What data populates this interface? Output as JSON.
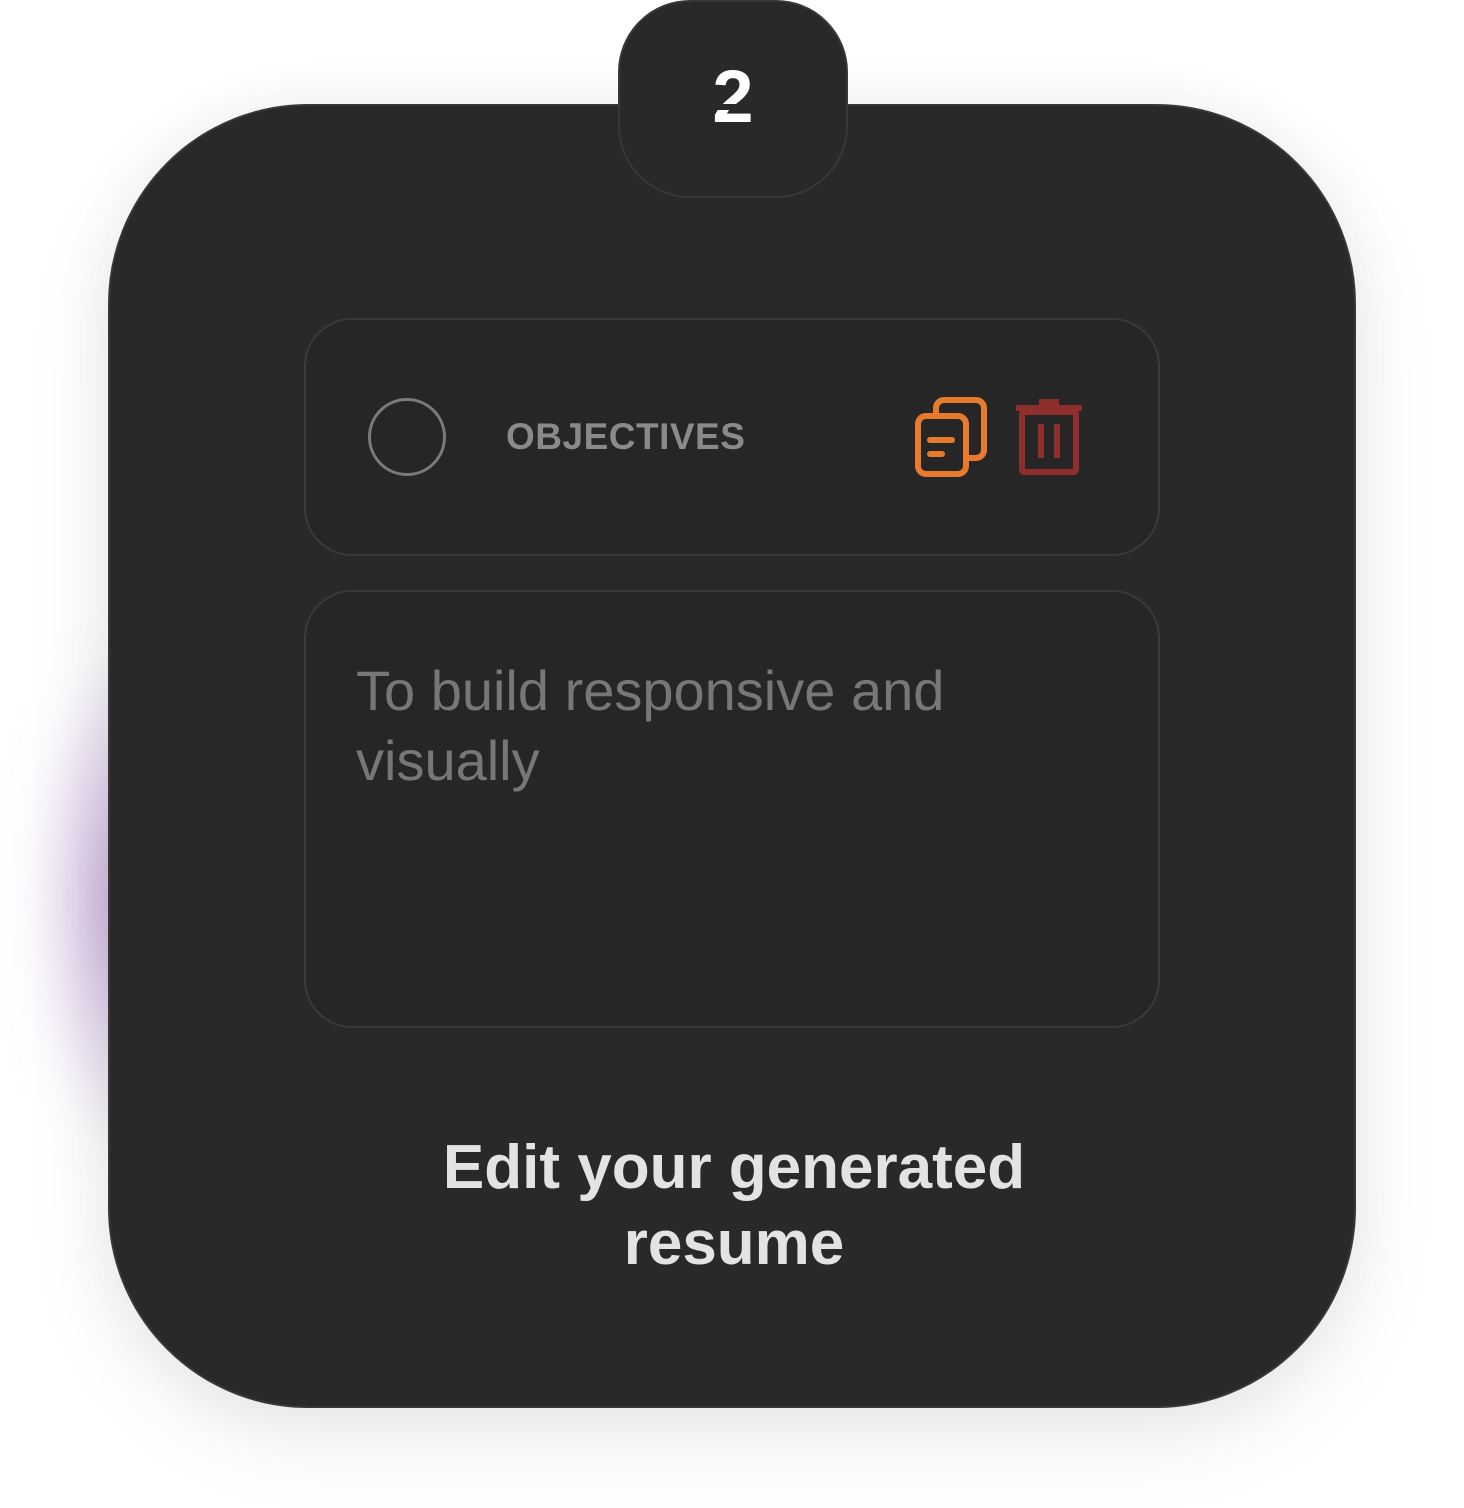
{
  "step": {
    "number": "2"
  },
  "section": {
    "title": "OBJECTIVES",
    "copy_icon": "copy-icon",
    "delete_icon": "trash-icon",
    "copy_color": "#E87A2E",
    "delete_color": "#8E2F2B"
  },
  "editor": {
    "text": "To build responsive and visually"
  },
  "caption": {
    "line1": "Edit your generated",
    "line2": "resume"
  },
  "colors": {
    "card_background": "#292929",
    "accent_glow": "#C9A9DD"
  }
}
